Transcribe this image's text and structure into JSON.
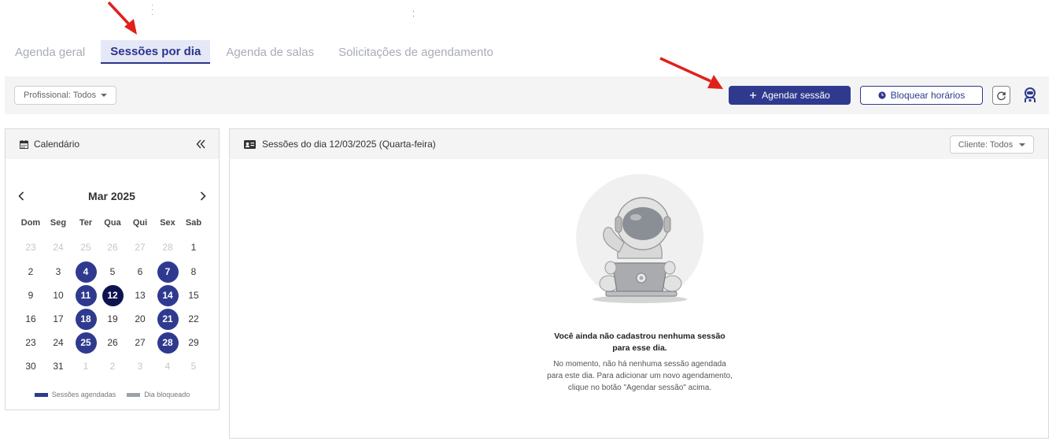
{
  "tabs": [
    {
      "label": "Agenda geral",
      "active": false
    },
    {
      "label": "Sessões por dia",
      "active": true
    },
    {
      "label": "Agenda de salas",
      "active": false
    },
    {
      "label": "Solicitações de agendamento",
      "active": false
    }
  ],
  "toolbar": {
    "professional_filter": "Profissional: Todos",
    "schedule_button": "Agendar sessão",
    "block_button": "Bloquear horários"
  },
  "calendar": {
    "title": "Calendário",
    "month": "Mar 2025",
    "weekdays": [
      "Dom",
      "Seg",
      "Ter",
      "Qua",
      "Qui",
      "Sex",
      "Sab"
    ],
    "weeks": [
      [
        "23",
        "24",
        "25",
        "26",
        "27",
        "28",
        "1"
      ],
      [
        "2",
        "3",
        "4",
        "5",
        "6",
        "7",
        "8"
      ],
      [
        "9",
        "10",
        "11",
        "12",
        "13",
        "14",
        "15"
      ],
      [
        "16",
        "17",
        "18",
        "19",
        "20",
        "21",
        "22"
      ],
      [
        "23",
        "24",
        "25",
        "26",
        "27",
        "28",
        "29"
      ],
      [
        "30",
        "31",
        "1",
        "2",
        "3",
        "4",
        "5"
      ]
    ],
    "legend": {
      "booked": "Sessões agendadas",
      "blocked": "Dia bloqueado"
    }
  },
  "sessions": {
    "title": "Sessões do dia 12/03/2025 (Quarta-feira)",
    "client_filter": "Cliente: Todos",
    "empty_title": "Você ainda não cadastrou nenhuma sessão para esse dia.",
    "empty_text": "No momento, não há nenhuma sessão agendada para este dia. Para adicionar um novo agendamento, clique no botão \"Agendar sessão\" acima."
  },
  "colors": {
    "primary": "#2f3a8f",
    "selected_day": "#0d1450",
    "blocked": "#9aa3ad",
    "annotation_arrow": "#e0201b"
  },
  "icons": [
    "calendar-icon",
    "double-chevron-left-icon",
    "chevron-left-icon",
    "chevron-right-icon",
    "id-card-icon",
    "plus-icon",
    "clock-icon",
    "refresh-icon",
    "user-icon",
    "caret-down-icon"
  ]
}
